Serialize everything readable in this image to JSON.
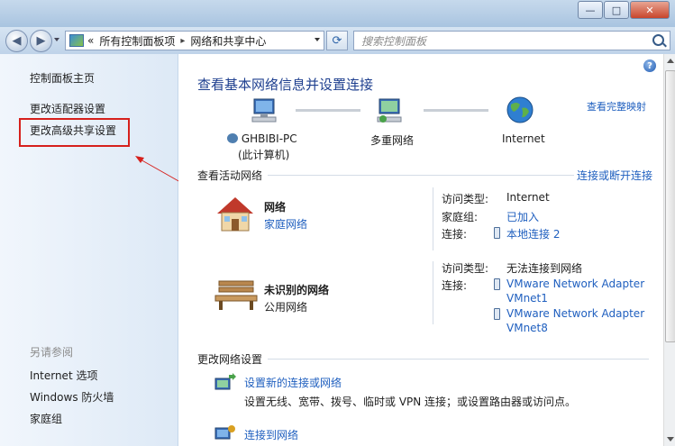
{
  "address": {
    "root_chevron": "«",
    "crumbs": [
      "所有控制面板项",
      "网络和共享中心"
    ],
    "separator": "▸"
  },
  "search": {
    "placeholder": "搜索控制面板"
  },
  "window_controls": {
    "minimize": "—",
    "maximize": "□",
    "close": "✕"
  },
  "sidebar": {
    "home": "控制面板主页",
    "items": [
      "更改适配器设置",
      "更改高级共享设置"
    ],
    "see_also_label": "另请参阅",
    "see_also": [
      "Internet 选项",
      "Windows 防火墙",
      "家庭组"
    ]
  },
  "main": {
    "title": "查看基本网络信息并设置连接",
    "full_map_link": "查看完整映射",
    "map": {
      "computer_name": "GHBIBI-PC",
      "computer_sub": "(此计算机)",
      "middle": "多重网络",
      "right": "Internet"
    },
    "active_section": {
      "heading": "查看活动网络",
      "link": "连接或断开连接",
      "networks": [
        {
          "name": "网络",
          "type": "家庭网络",
          "access_label": "访问类型:",
          "access_value": "Internet",
          "homegroup_label": "家庭组:",
          "homegroup_value": "已加入",
          "conn_label": "连接:",
          "conn_values": [
            "本地连接 2"
          ]
        },
        {
          "name": "未识别的网络",
          "type": "公用网络",
          "access_label": "访问类型:",
          "access_value": "无法连接到网络",
          "conn_label": "连接:",
          "conn_values": [
            "VMware Network Adapter",
            "VMnet1",
            "VMware Network Adapter",
            "VMnet8"
          ]
        }
      ]
    },
    "change_section": {
      "heading": "更改网络设置",
      "tasks": [
        {
          "link": "设置新的连接或网络",
          "desc": "设置无线、宽带、拨号、临时或 VPN 连接；或设置路由器或访问点。"
        },
        {
          "link": "连接到网络"
        }
      ]
    }
  },
  "colors": {
    "link": "#1f5fbf",
    "title": "#1e3f8f",
    "highlight": "#d6201c"
  },
  "icons": [
    "back-icon",
    "forward-icon",
    "control-panel-icon",
    "refresh-icon",
    "search-icon",
    "help-icon",
    "computer-icon",
    "network-icon",
    "globe-icon",
    "house-icon",
    "bench-icon",
    "plug-icon",
    "new-connection-icon",
    "connect-icon"
  ]
}
